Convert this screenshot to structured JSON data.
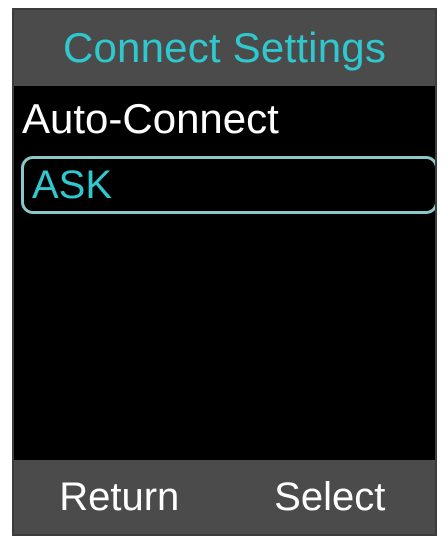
{
  "header": {
    "title": "Connect Settings"
  },
  "setting": {
    "label": "Auto-Connect",
    "selected_value": "ASK"
  },
  "softkeys": {
    "left_label": "Return",
    "right_label": "Select"
  },
  "colors": {
    "accent": "#2fc8cf",
    "panel": "#4b4b4b",
    "background": "#000000",
    "text": "#ffffff",
    "focus_border": "#8ac8ca"
  }
}
